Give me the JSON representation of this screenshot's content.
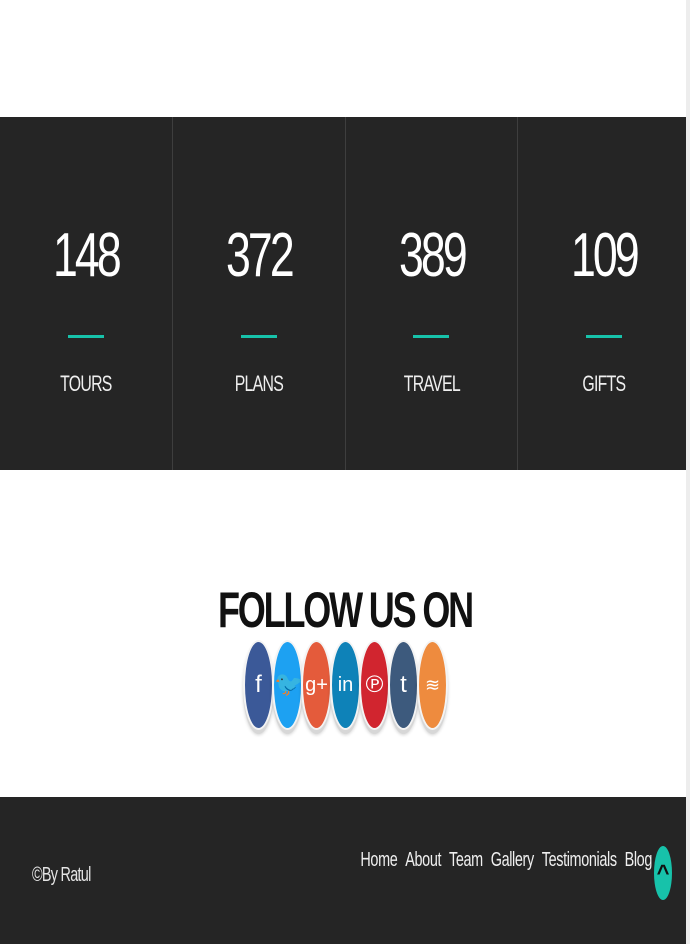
{
  "stats": [
    {
      "value": "148",
      "label": "TOURS"
    },
    {
      "value": "372",
      "label": "PLANS"
    },
    {
      "value": "389",
      "label": "TRAVEL"
    },
    {
      "value": "109",
      "label": "GIFTS"
    }
  ],
  "follow": {
    "title": "FOLLOW US ON",
    "icons": [
      {
        "name": "facebook-icon",
        "glyph": "f"
      },
      {
        "name": "twitter-icon",
        "glyph": "🐦"
      },
      {
        "name": "google-plus-icon",
        "glyph": "g+"
      },
      {
        "name": "linkedin-icon",
        "glyph": "in"
      },
      {
        "name": "pinterest-icon",
        "glyph": "℗"
      },
      {
        "name": "tumblr-icon",
        "glyph": "t"
      },
      {
        "name": "rss-icon",
        "glyph": "≋"
      }
    ]
  },
  "footer": {
    "copyright": "©By Ratul",
    "nav": [
      "Home",
      "About",
      "Team",
      "Gallery",
      "Testimonials",
      "Blog"
    ],
    "back_to_top": "^"
  },
  "colors": {
    "dark_bg": "#252525",
    "accent": "#17c2aa"
  }
}
